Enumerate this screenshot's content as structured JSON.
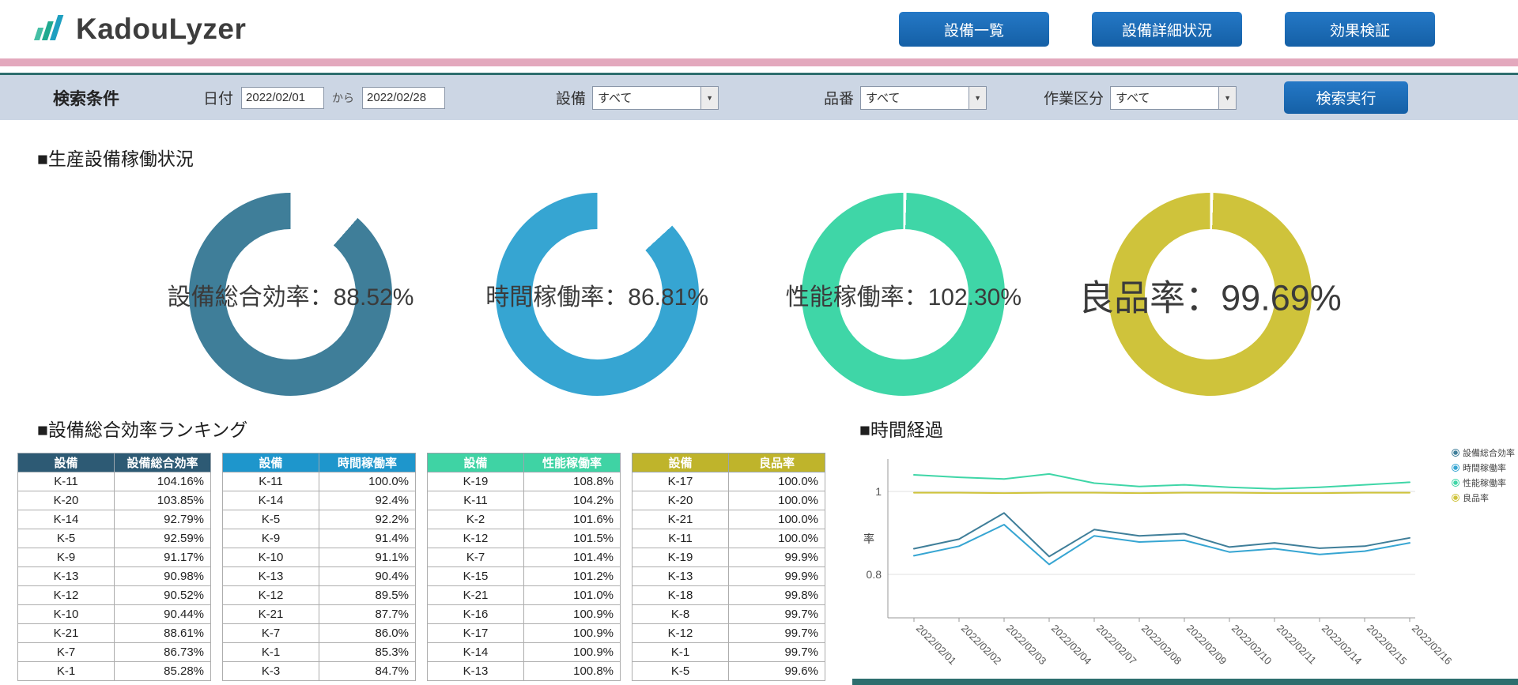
{
  "colors": {
    "primary_blue": "#1a6cb8",
    "pink_accent": "#e3a8bd",
    "search_bg": "#ccd6e4",
    "teal_line": "#2d6e6e"
  },
  "header": {
    "logo": "KadouLyzer",
    "nav_buttons": [
      "設備一覧",
      "設備詳細状況",
      "効果検証"
    ]
  },
  "search": {
    "title": "検索条件",
    "date": {
      "label": "日付",
      "from": "2022/02/01",
      "connector": "から",
      "to": "2022/02/28"
    },
    "filters": [
      {
        "label": "設備",
        "value": "すべて"
      },
      {
        "label": "品番",
        "value": "すべて"
      },
      {
        "label": "作業区分",
        "value": "すべて"
      }
    ],
    "execute": "検索実行"
  },
  "status_section": {
    "title": "■生産設備稼働状況",
    "donuts": [
      {
        "label": "設備総合効率：88.52%",
        "value": 88.52,
        "color": "#3f7e99",
        "large": false
      },
      {
        "label": "時間稼働率：86.81%",
        "value": 86.81,
        "color": "#36a5d2",
        "large": false
      },
      {
        "label": "性能稼働率：102.30%",
        "value": 102.3,
        "color": "#3fd6a7",
        "large": false
      },
      {
        "label": "良品率：99.69%",
        "value": 99.69,
        "color": "#cfc33b",
        "large": true
      }
    ]
  },
  "ranking_section": {
    "title": "■設備総合効率ランキング",
    "tables": [
      {
        "header_color": "#2d5a74",
        "columns": [
          "設備",
          "設備総合効率"
        ],
        "rows": [
          [
            "K-11",
            "104.16%"
          ],
          [
            "K-20",
            "103.85%"
          ],
          [
            "K-14",
            "92.79%"
          ],
          [
            "K-5",
            "92.59%"
          ],
          [
            "K-9",
            "91.17%"
          ],
          [
            "K-13",
            "90.98%"
          ],
          [
            "K-12",
            "90.52%"
          ],
          [
            "K-10",
            "90.44%"
          ],
          [
            "K-21",
            "88.61%"
          ],
          [
            "K-7",
            "86.73%"
          ],
          [
            "K-1",
            "85.28%"
          ]
        ]
      },
      {
        "header_color": "#1e96cc",
        "columns": [
          "設備",
          "時間稼働率"
        ],
        "rows": [
          [
            "K-11",
            "100.0%"
          ],
          [
            "K-14",
            "92.4%"
          ],
          [
            "K-5",
            "92.2%"
          ],
          [
            "K-9",
            "91.4%"
          ],
          [
            "K-10",
            "91.1%"
          ],
          [
            "K-13",
            "90.4%"
          ],
          [
            "K-12",
            "89.5%"
          ],
          [
            "K-21",
            "87.7%"
          ],
          [
            "K-7",
            "86.0%"
          ],
          [
            "K-1",
            "85.3%"
          ],
          [
            "K-3",
            "84.7%"
          ]
        ]
      },
      {
        "header_color": "#3fd3a4",
        "columns": [
          "設備",
          "性能稼働率"
        ],
        "rows": [
          [
            "K-19",
            "108.8%"
          ],
          [
            "K-11",
            "104.2%"
          ],
          [
            "K-2",
            "101.6%"
          ],
          [
            "K-12",
            "101.5%"
          ],
          [
            "K-7",
            "101.4%"
          ],
          [
            "K-15",
            "101.2%"
          ],
          [
            "K-21",
            "101.0%"
          ],
          [
            "K-16",
            "100.9%"
          ],
          [
            "K-17",
            "100.9%"
          ],
          [
            "K-14",
            "100.9%"
          ],
          [
            "K-13",
            "100.8%"
          ]
        ]
      },
      {
        "header_color": "#bfb42b",
        "columns": [
          "設備",
          "良品率"
        ],
        "rows": [
          [
            "K-17",
            "100.0%"
          ],
          [
            "K-20",
            "100.0%"
          ],
          [
            "K-21",
            "100.0%"
          ],
          [
            "K-11",
            "100.0%"
          ],
          [
            "K-19",
            "99.9%"
          ],
          [
            "K-13",
            "99.9%"
          ],
          [
            "K-18",
            "99.8%"
          ],
          [
            "K-8",
            "99.7%"
          ],
          [
            "K-12",
            "99.7%"
          ],
          [
            "K-1",
            "99.7%"
          ],
          [
            "K-5",
            "99.6%"
          ]
        ]
      }
    ]
  },
  "timeline_section": {
    "title": "■時間経過",
    "chart_data": {
      "type": "line",
      "ylabel": "率",
      "yticks": [
        1,
        0.8
      ],
      "ylim": [
        0.7,
        1.09
      ],
      "grid": true,
      "legend_position": "top-right",
      "x": [
        "2022/02/01",
        "2022/02/02",
        "2022/02/03",
        "2022/02/04",
        "2022/02/07",
        "2022/02/08",
        "2022/02/09",
        "2022/02/10",
        "2022/02/11",
        "2022/02/14",
        "2022/02/15",
        "2022/02/16"
      ],
      "series": [
        {
          "name": "設備総合効率",
          "color": "#3f7e99",
          "values": [
            0.862,
            0.885,
            0.948,
            0.843,
            0.908,
            0.893,
            0.898,
            0.866,
            0.876,
            0.863,
            0.868,
            0.888
          ]
        },
        {
          "name": "時間稼働率",
          "color": "#36a5d2",
          "values": [
            0.845,
            0.868,
            0.92,
            0.824,
            0.893,
            0.878,
            0.882,
            0.854,
            0.862,
            0.848,
            0.856,
            0.876
          ]
        },
        {
          "name": "性能稼働率",
          "color": "#3fd6a7",
          "values": [
            1.04,
            1.034,
            1.03,
            1.042,
            1.02,
            1.012,
            1.016,
            1.01,
            1.006,
            1.01,
            1.016,
            1.022
          ]
        },
        {
          "name": "良品率",
          "color": "#cfc33b",
          "values": [
            0.997,
            0.997,
            0.996,
            0.997,
            0.997,
            0.996,
            0.997,
            0.997,
            0.996,
            0.996,
            0.997,
            0.997
          ]
        }
      ]
    }
  }
}
